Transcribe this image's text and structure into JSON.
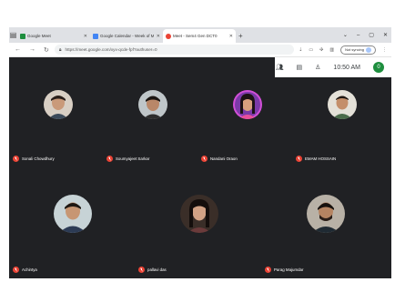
{
  "browser": {
    "tabs": [
      {
        "label": "Google Meet",
        "favicon_color": "#1e8e3e",
        "active": false
      },
      {
        "label": "Google Calendar - Week of Mo",
        "favicon_color": "#4285f4",
        "active": false
      },
      {
        "label": "Meet - Sem4 Gen DCT0",
        "favicon_color": "#ea4335",
        "active": true
      }
    ],
    "url": "https://meet.google.com/xyx-qcde-fpf?authuser=0",
    "resume_label": "Not syncing"
  },
  "meet": {
    "clock": "10:50 AM",
    "self_initial": "0",
    "participants": [
      {
        "name": "Sonali Chowdhury"
      },
      {
        "name": "Soumyajeet Sarkar"
      },
      {
        "name": "Nandani Oraon"
      },
      {
        "name": "EMAM HOSSAIN"
      },
      {
        "name": "Achintya"
      },
      {
        "name": "pallavi das"
      },
      {
        "name": "Parag Majumdar"
      }
    ]
  },
  "colors": {
    "meet_bg": "#202124",
    "mic_off": "#ea4335",
    "self_avatar": "#1e8e3e"
  }
}
